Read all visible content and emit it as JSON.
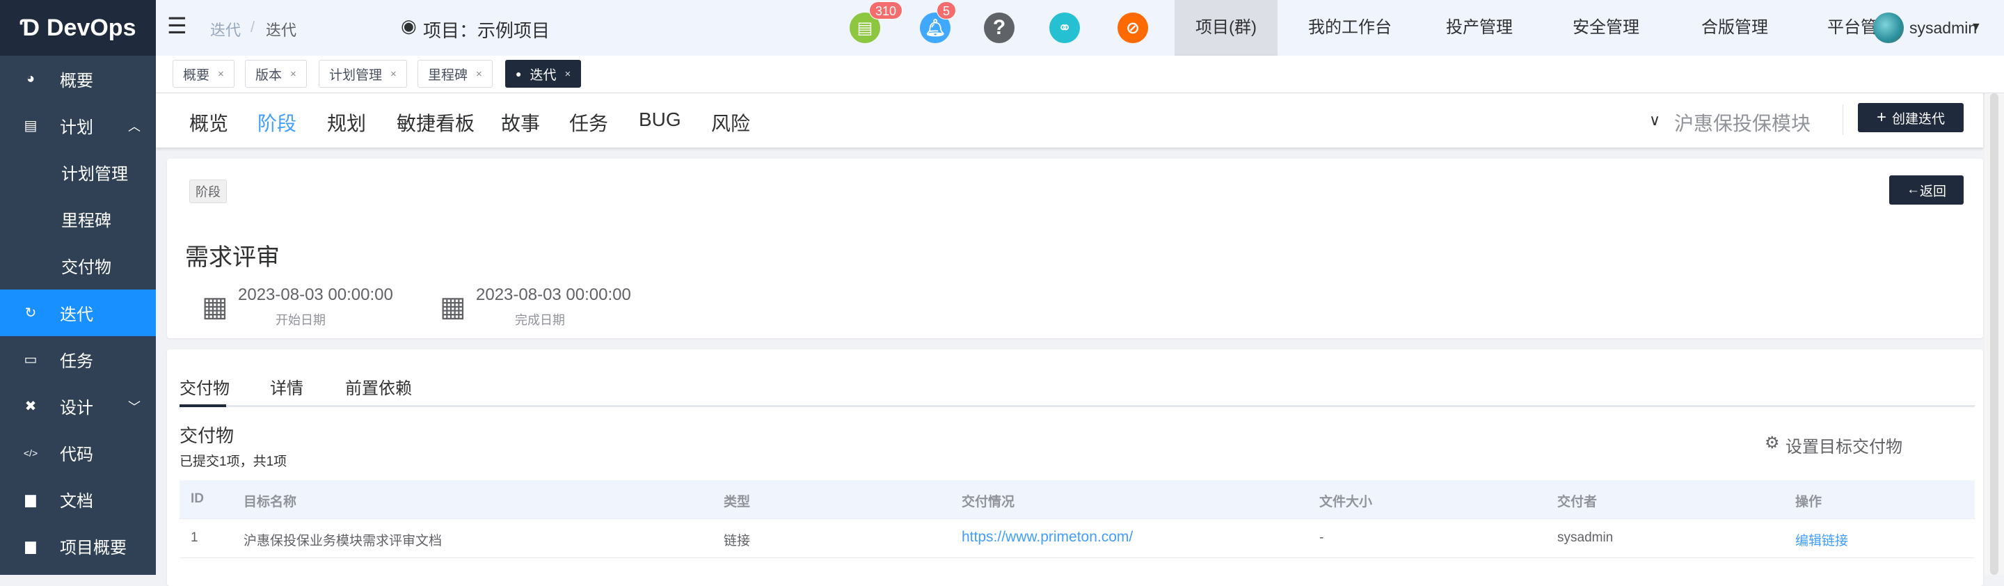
{
  "brand": {
    "name": "DevOps"
  },
  "header": {
    "breadcrumb": [
      "迭代",
      "迭代"
    ],
    "breadcrumb_sep": "/",
    "project_label": "项目：示例项目",
    "icons": [
      {
        "name": "document-icon",
        "color": "#8dc63f",
        "badge": "310"
      },
      {
        "name": "bell-icon",
        "color": "#40a9ff",
        "badge": "5"
      },
      {
        "name": "help-icon",
        "color": "#5f6368"
      },
      {
        "name": "link-icon",
        "color": "#26c0d3"
      },
      {
        "name": "block-icon",
        "color": "#ff6a00"
      }
    ],
    "nav": [
      "项目(群)",
      "我的工作台",
      "投产管理",
      "安全管理",
      "合版管理",
      "平台管理"
    ],
    "user": "sysadmin"
  },
  "sidebar": {
    "items": [
      {
        "label": "概要",
        "icon": "dashboard-icon"
      },
      {
        "label": "计划",
        "icon": "plan-icon"
      },
      {
        "label": "计划管理"
      },
      {
        "label": "里程碑"
      },
      {
        "label": "交付物"
      },
      {
        "label": "迭代",
        "icon": "iteration-icon"
      },
      {
        "label": "任务",
        "icon": "task-icon"
      },
      {
        "label": "设计",
        "icon": "design-icon"
      },
      {
        "label": "代码",
        "icon": "code-icon"
      },
      {
        "label": "文档",
        "icon": "doc-icon"
      },
      {
        "label": "项目概要",
        "icon": "doc-icon"
      }
    ]
  },
  "tags": [
    {
      "label": "概要"
    },
    {
      "label": "版本"
    },
    {
      "label": "计划管理"
    },
    {
      "label": "里程碑"
    },
    {
      "label": "迭代",
      "active": true
    }
  ],
  "subnav": {
    "items": [
      "概览",
      "阶段",
      "规划",
      "敏捷看板",
      "故事",
      "任务",
      "BUG",
      "风险"
    ],
    "active": "阶段",
    "module": "沪惠保投保模块",
    "create_label": "创建迭代"
  },
  "stage": {
    "tag": "阶段",
    "back_label": "返回",
    "title": "需求评审",
    "start_date": "2023-08-03 00:00:00",
    "start_label": "开始日期",
    "end_date": "2023-08-03 00:00:00",
    "end_label": "完成日期"
  },
  "detail": {
    "tabs": [
      "交付物",
      "详情",
      "前置依赖"
    ],
    "section_title": "交付物",
    "summary": "已提交1项，共1项",
    "set_target_label": "设置目标交付物",
    "columns": [
      "ID",
      "目标名称",
      "类型",
      "交付情况",
      "文件大小",
      "交付者",
      "操作"
    ],
    "rows": [
      {
        "id": "1",
        "name": "沪惠保投保业务模块需求评审文档",
        "type": "链接",
        "status": "https://www.primeton.com/",
        "size": "-",
        "by": "sysadmin",
        "action": "编辑链接"
      }
    ]
  }
}
